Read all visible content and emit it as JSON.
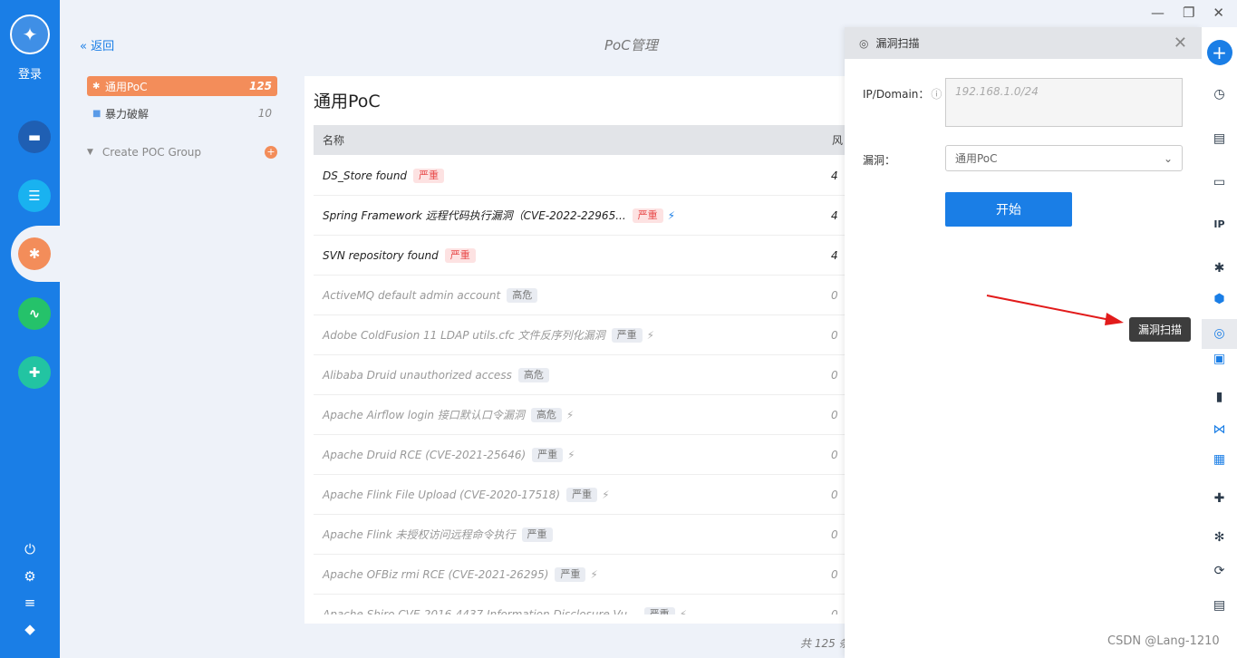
{
  "rail": {
    "login": "登录",
    "logo_icon": "rocket-icon"
  },
  "header": {
    "back": "« 返回",
    "title": "PoC管理",
    "controls": [
      "—",
      "❐",
      "✕"
    ]
  },
  "groups": [
    {
      "label": "通用PoC",
      "count": "125",
      "icon": "bug-icon"
    },
    {
      "label": "暴力破解",
      "count": "10",
      "icon": "lock-icon"
    }
  ],
  "create_group": "Create POC Group",
  "main": {
    "title": "通用PoC",
    "col_name": "名称",
    "col_risk": "风",
    "rows": [
      {
        "name": "DS_Store found",
        "sev": "严重",
        "bolt": false,
        "count": "4",
        "hi": true
      },
      {
        "name": "Spring Framework 远程代码执行漏洞（CVE-2022-22965...",
        "sev": "严重",
        "bolt": true,
        "count": "4",
        "hi": true
      },
      {
        "name": "SVN repository found",
        "sev": "严重",
        "bolt": false,
        "count": "4",
        "hi": true
      },
      {
        "name": "ActiveMQ default admin account",
        "sev": "高危",
        "bolt": false,
        "count": "0",
        "hi": false
      },
      {
        "name": "Adobe ColdFusion 11 LDAP utils.cfc 文件反序列化漏洞",
        "sev": "严重",
        "bolt": true,
        "count": "0",
        "hi": false
      },
      {
        "name": "Alibaba Druid unauthorized access",
        "sev": "高危",
        "bolt": false,
        "count": "0",
        "hi": false
      },
      {
        "name": "Apache Airflow login 接口默认口令漏洞",
        "sev": "高危",
        "bolt": true,
        "count": "0",
        "hi": false
      },
      {
        "name": "Apache Druid RCE (CVE-2021-25646)",
        "sev": "严重",
        "bolt": true,
        "count": "0",
        "hi": false
      },
      {
        "name": "Apache Flink File Upload (CVE-2020-17518)",
        "sev": "严重",
        "bolt": true,
        "count": "0",
        "hi": false
      },
      {
        "name": "Apache Flink 未授权访问远程命令执行",
        "sev": "严重",
        "bolt": false,
        "count": "0",
        "hi": false
      },
      {
        "name": "Apache OFBiz rmi RCE (CVE-2021-26295)",
        "sev": "严重",
        "bolt": true,
        "count": "0",
        "hi": false
      },
      {
        "name": "Apache Shiro CVE-2016-4437 Information Disclosure Vu...",
        "sev": "严重",
        "bolt": true,
        "count": "0",
        "hi": false
      }
    ],
    "footer": "共 125 条"
  },
  "scan": {
    "title": "漏洞扫描",
    "ip_label": "IP/Domain：",
    "ip_placeholder": "192.168.1.0/24",
    "vuln_label": "漏洞：",
    "vuln_value": "通用PoC",
    "start": "开始"
  },
  "tooltip": "漏洞扫描",
  "watermark": "CSDN @Lang-1210"
}
